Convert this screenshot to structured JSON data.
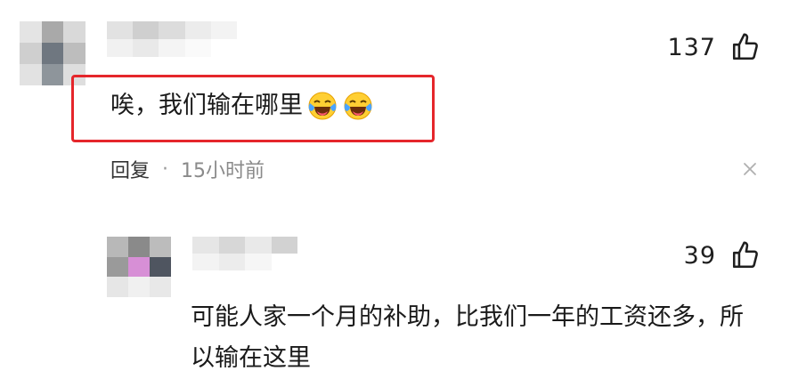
{
  "comment": {
    "likes": "137",
    "text": "唉，我们输在哪里",
    "emojis": [
      "laugh-cry-emoji",
      "laugh-cry-emoji"
    ],
    "reply_label": "回复",
    "dot": "·",
    "time": "15小时前",
    "highlight_color": "#e5262b"
  },
  "reply": {
    "likes": "39",
    "text": "可能人家一个月的补助，比我们一年的工资还多，所以输在这里"
  },
  "icons": {
    "like": "thumbs-up-icon",
    "close": "close-icon"
  }
}
